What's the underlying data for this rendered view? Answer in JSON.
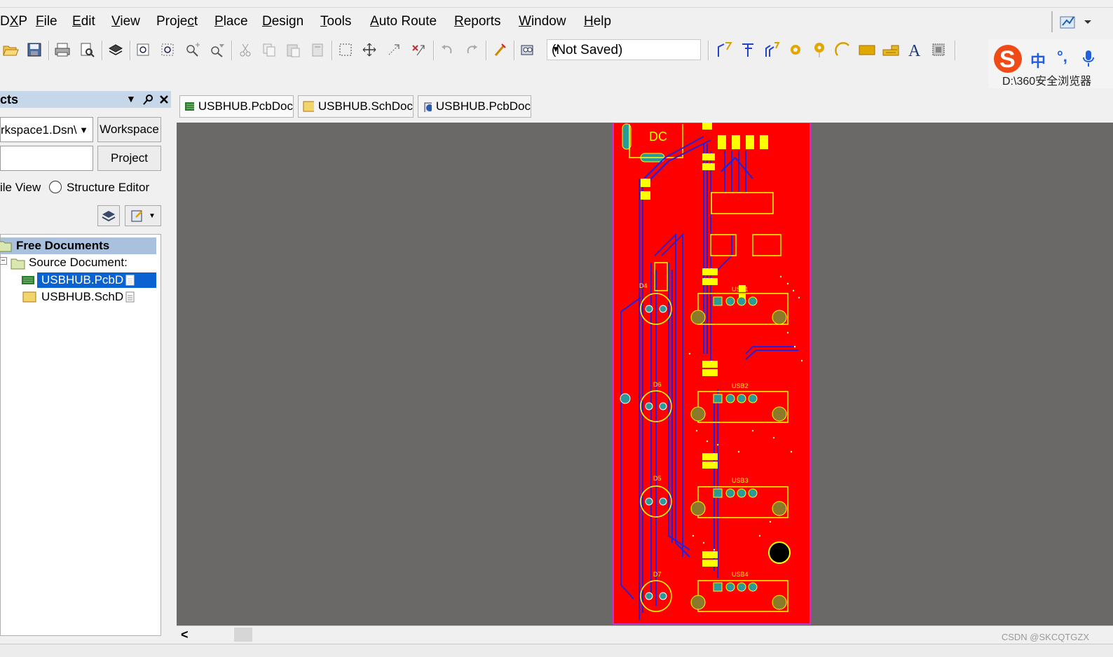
{
  "menubar": {
    "items": [
      "DXP",
      "File",
      "Edit",
      "View",
      "Project",
      "Place",
      "Design",
      "Tools",
      "Auto Route",
      "Reports",
      "Window",
      "Help"
    ],
    "underline": [
      "X",
      "F",
      "E",
      "V",
      "c",
      "P",
      "D",
      "T",
      "A",
      "R",
      "W",
      "H"
    ]
  },
  "toolbar": {
    "combo_value": "(Not Saved)"
  },
  "ime": {
    "logo": "S",
    "mode": "中",
    "punct": "°,",
    "path": "D:\\360安全浏览器"
  },
  "panel": {
    "title": "cts",
    "workspace_combo": "rkspace1.Dsn\\",
    "workspace_button": "Workspace",
    "project_button": "Project",
    "file_view_label": "ile View",
    "structure_editor_label": "Structure Editor",
    "tree": {
      "free_documents": "Free Documents",
      "source_documents": "Source Document:",
      "file1": "USBHUB.PcbD",
      "file2": "USBHUB.SchD"
    }
  },
  "tabs": [
    "USBHUB.PcbDoc",
    "USBHUB.SchDoc",
    "USBHUB.PcbDoc"
  ],
  "pcb": {
    "dc_label": "DC",
    "usb_labels": [
      "USB1",
      "USB2",
      "USB3",
      "USB4"
    ],
    "diode_labels": [
      "D4",
      "D6",
      "D5",
      "D7"
    ]
  },
  "colors": {
    "board": "#ff0000",
    "silk": "#ffff00",
    "track": "#2222dd",
    "canvas": "#6b6868",
    "outline": "#cc33cc"
  },
  "scroll": {
    "left_arrow": "<"
  },
  "watermark": "CSDN @SKCQTGZX"
}
